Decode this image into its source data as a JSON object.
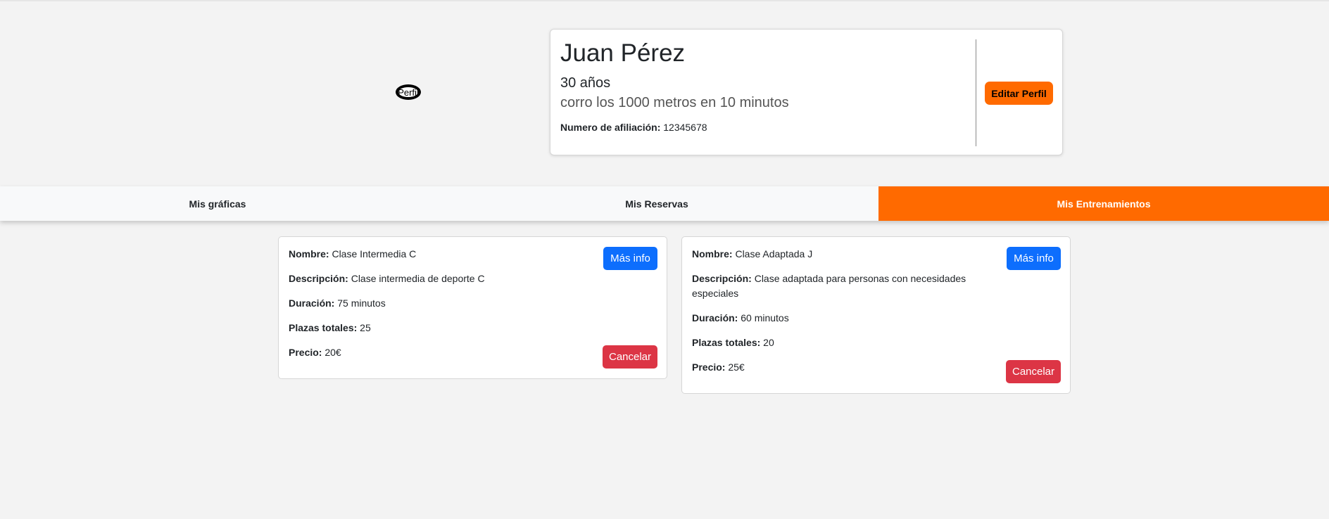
{
  "profile": {
    "avatar_alt": "Perfil",
    "name": "Juan Pérez",
    "age": "30 años",
    "motto": "corro los 1000 metros en 10 minutos",
    "affiliation_label": "Numero de afiliación:",
    "affiliation_value": "12345678",
    "edit_label": "Editar Perfil"
  },
  "tabs": [
    {
      "label": "Mis gráficas",
      "active": false
    },
    {
      "label": "Mis Reservas",
      "active": false
    },
    {
      "label": "Mis Entrenamientos",
      "active": true
    }
  ],
  "labels": {
    "name": "Nombre:",
    "description": "Descripción:",
    "duration": "Duración:",
    "spots": "Plazas totales:",
    "price": "Precio:",
    "info_button": "Más info",
    "cancel_button": "Cancelar"
  },
  "classes": [
    {
      "name": "Clase Intermedia C",
      "description": "Clase intermedia de deporte C",
      "duration": "75 minutos",
      "spots": "25",
      "price": "20€"
    },
    {
      "name": "Clase Adaptada J",
      "description": "Clase adaptada para personas con necesidades especiales",
      "duration": "60 minutos",
      "spots": "20",
      "price": "25€"
    }
  ],
  "colors": {
    "accent": "#ff6a00",
    "primary": "#0d6efd",
    "danger": "#dc3545",
    "background": "#f3f3f3"
  }
}
